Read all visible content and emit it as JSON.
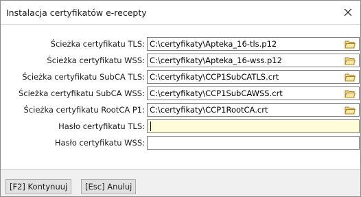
{
  "window": {
    "title": "Instalacja certyfikatów e-recepty"
  },
  "form": {
    "fields": [
      {
        "label": "Ścieżka certyfikatu TLS:",
        "value": "C:\\certyfikaty\\Apteka_16-tls.p12"
      },
      {
        "label": "Ścieżka certyfikatu WSS:",
        "value": "C:\\certyfikaty\\Apteka_16-wss.p12"
      },
      {
        "label": "Ścieżka certyfikatu SubCA TLS:",
        "value": "C:\\certyfikaty\\CCP1SubCATLS.crt"
      },
      {
        "label": "Ścieżka certyfikatu SubCA WSS:",
        "value": "C:\\certyfikaty\\CCP1SubCAWSS.crt"
      },
      {
        "label": "Ścieżka certyfikatu RootCA P1:",
        "value": "C:\\certyfikaty\\CCP1RootCA.crt"
      },
      {
        "label": "Hasło certyfikatu TLS:",
        "value": ""
      },
      {
        "label": "Hasło certyfikatu WSS:",
        "value": ""
      }
    ],
    "browse_icon": "folder-open-icon"
  },
  "footer": {
    "continue_label": "[F2] Kontynuuj",
    "cancel_label": "[Esc] Anuluj"
  },
  "colors": {
    "focused_field_bg": "#fffdd9",
    "folder_icon": "#e8c34a"
  }
}
